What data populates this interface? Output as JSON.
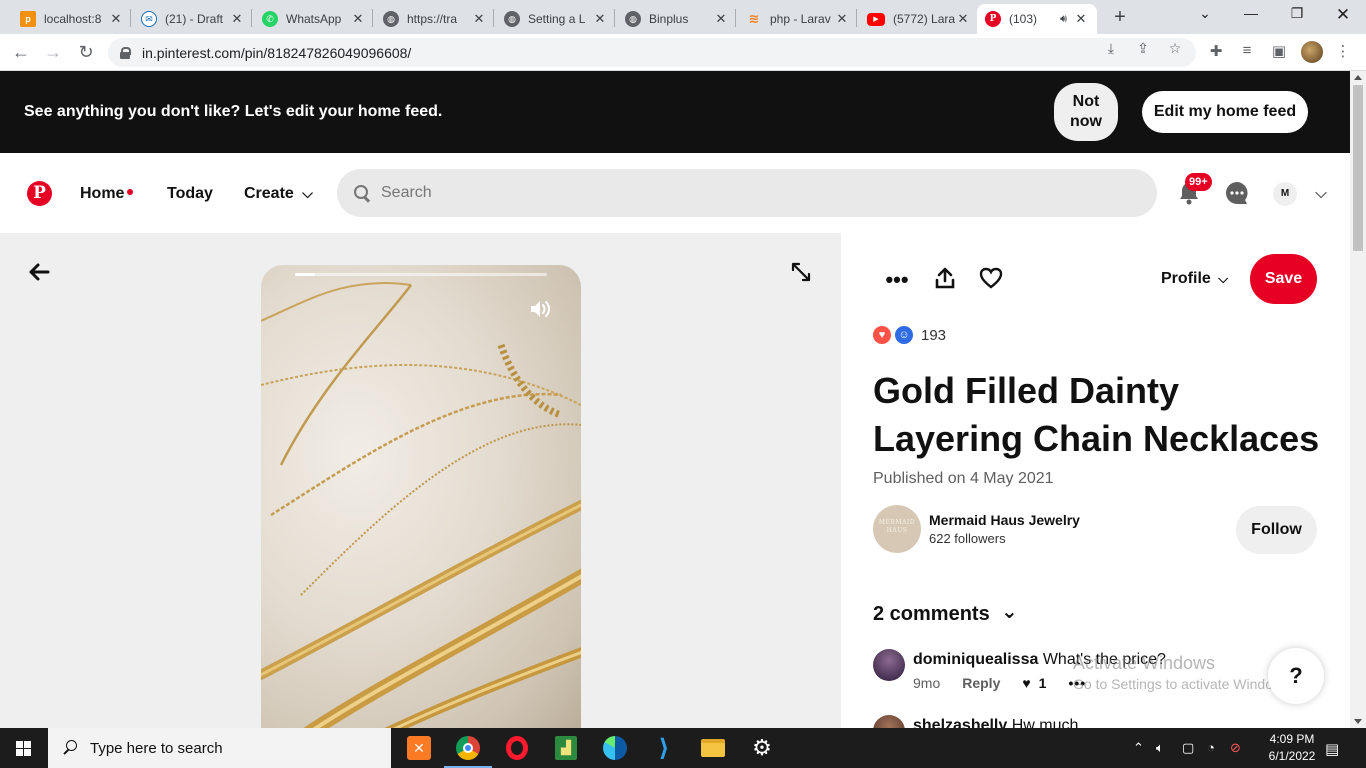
{
  "browser": {
    "tabs": [
      {
        "title": "localhost:8",
        "icon": "phpmyadmin-icon",
        "color": "#f29111"
      },
      {
        "title": "(21) - Draft",
        "icon": "outlook-icon",
        "color": "#0f6cbd"
      },
      {
        "title": "WhatsApp",
        "icon": "whatsapp-icon",
        "color": "#25d366"
      },
      {
        "title": "https://tra",
        "icon": "globe-icon",
        "color": "#5f6368"
      },
      {
        "title": "Setting a L",
        "icon": "globe-icon",
        "color": "#5f6368"
      },
      {
        "title": "Binplus",
        "icon": "globe-icon",
        "color": "#5f6368"
      },
      {
        "title": "php - Larav",
        "icon": "stackoverflow-icon",
        "color": "#f48024"
      },
      {
        "title": "(5772) Lara",
        "icon": "youtube-icon",
        "color": "#ff0000"
      },
      {
        "title": "(103)",
        "icon": "pinterest-icon",
        "color": "#e60023"
      }
    ],
    "url": "in.pinterest.com/pin/818247826049096608/"
  },
  "banner": {
    "text": "See anything you don't like? Let's edit your home feed.",
    "not_now_line1": "Not",
    "not_now_line2": "now",
    "edit_feed": "Edit my home feed"
  },
  "header": {
    "logo": "P",
    "nav": {
      "home": "Home",
      "today": "Today",
      "create": "Create"
    },
    "search_placeholder": "Search",
    "notification_badge": "99+",
    "user_initial": "M",
    "brand_color": "#e60023"
  },
  "video": {
    "progress": 0.08
  },
  "pin": {
    "profile_label": "Profile",
    "save_label": "Save",
    "reaction_count": "193",
    "title": "Gold Filled Dainty Layering Chain Necklaces",
    "published": "Published on 4 May 2021",
    "creator": {
      "name": "Mermaid Haus Jewelry",
      "followers": "622 followers",
      "avatar_line1": "MERMAID",
      "avatar_line2": "HAUS"
    },
    "follow_label": "Follow",
    "comments_header": "2 comments",
    "comments": [
      {
        "user": "dominiquealissa",
        "text": "What's the price?",
        "time": "9mo",
        "reply": "Reply",
        "likes": "1"
      },
      {
        "user": "shelzashelly",
        "text": "Hw much"
      }
    ],
    "help_label": "?"
  },
  "watermark": {
    "line1": "Activate Windows",
    "line2": "Go to Settings to activate Windows."
  },
  "taskbar": {
    "search_placeholder": "Type here to search",
    "time": "4:09 PM",
    "date": "6/1/2022"
  }
}
